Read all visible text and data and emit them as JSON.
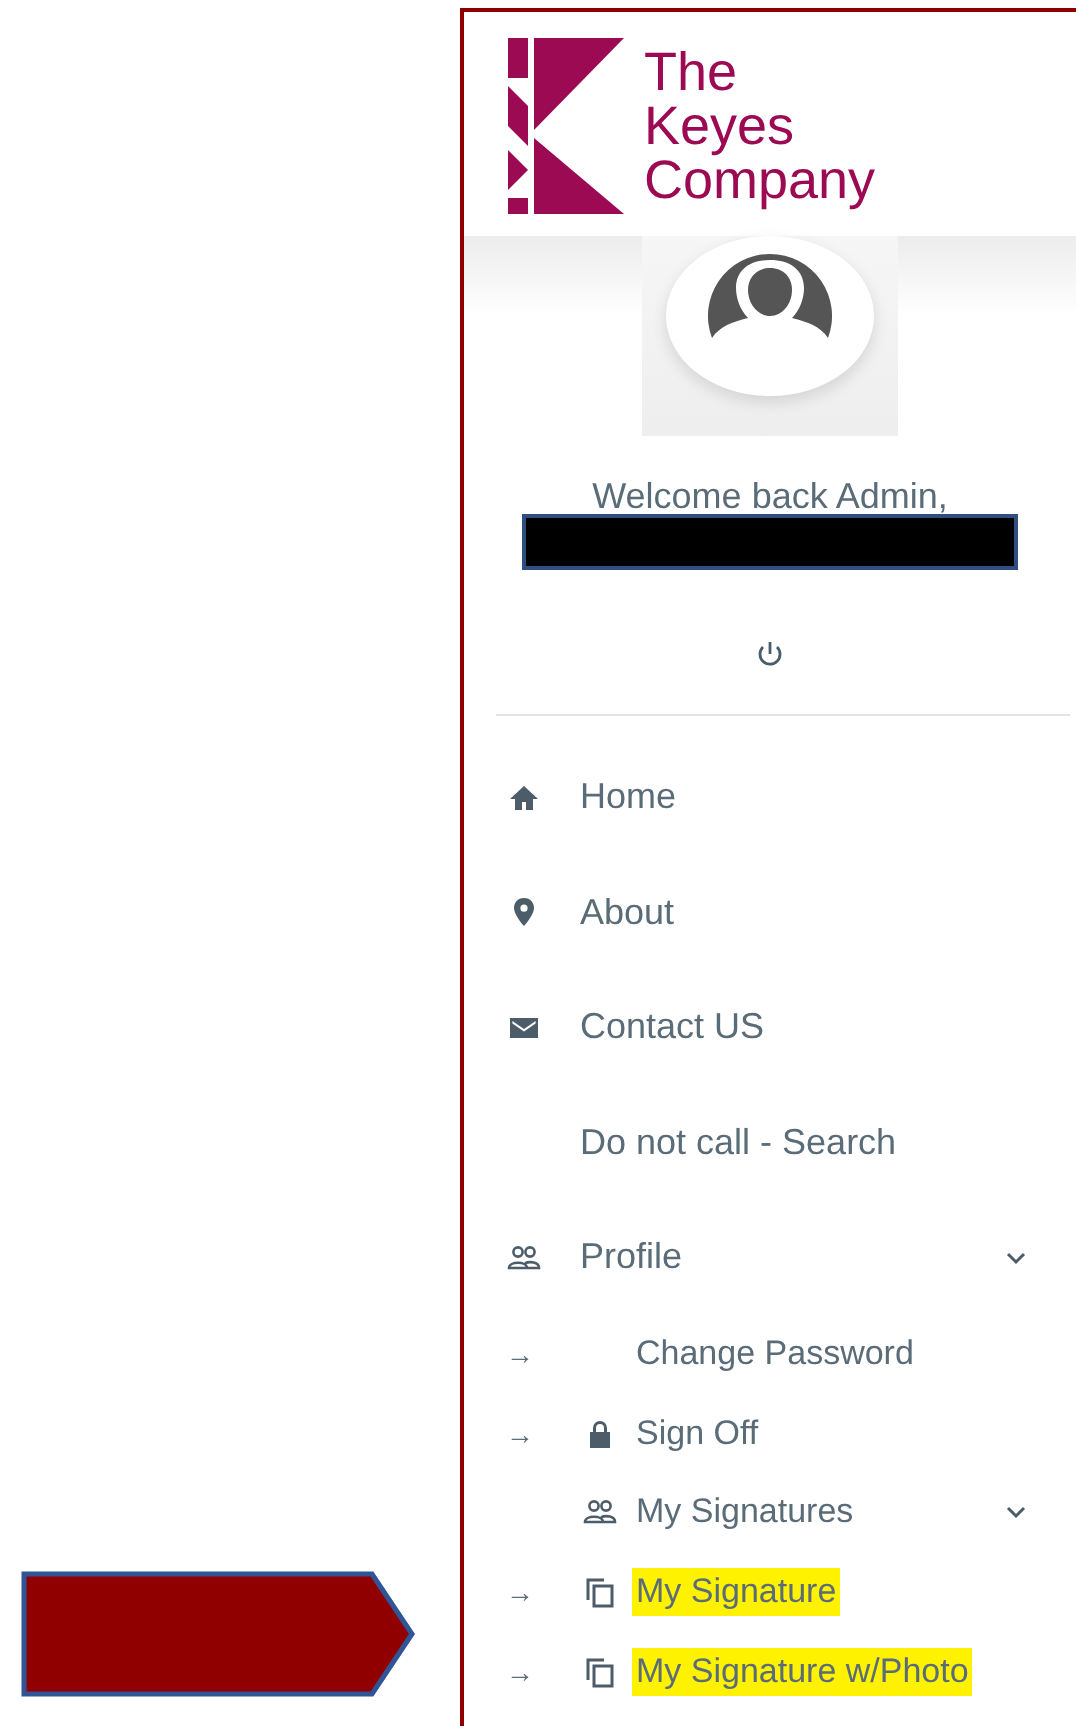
{
  "logo": {
    "lines": [
      "The",
      "Keyes",
      "Company"
    ]
  },
  "user": {
    "welcome": "Welcome back Admin,",
    "name_redacted": true
  },
  "nav": [
    {
      "label": "Home",
      "kind": "home"
    },
    {
      "label": "About",
      "kind": "pin"
    },
    {
      "label": "Contact US",
      "kind": "mail"
    },
    {
      "label": "Do not call - Search",
      "kind": "plain"
    },
    {
      "label": "Profile",
      "kind": "people",
      "expanded": true,
      "children": [
        {
          "label": "Change Password",
          "kind": "plain",
          "bullet": "→"
        },
        {
          "label": "Sign Off",
          "kind": "lock",
          "bullet": "→"
        },
        {
          "label": "My Signatures",
          "kind": "people",
          "expanded": true,
          "children": [
            {
              "label": "My Signature",
              "kind": "copy",
              "bullet": "→",
              "highlighted": true
            },
            {
              "label": "My Signature w/Photo",
              "kind": "copy",
              "bullet": "→",
              "highlighted": true
            }
          ]
        }
      ]
    }
  ],
  "callout": {
    "kind": "arrow"
  }
}
